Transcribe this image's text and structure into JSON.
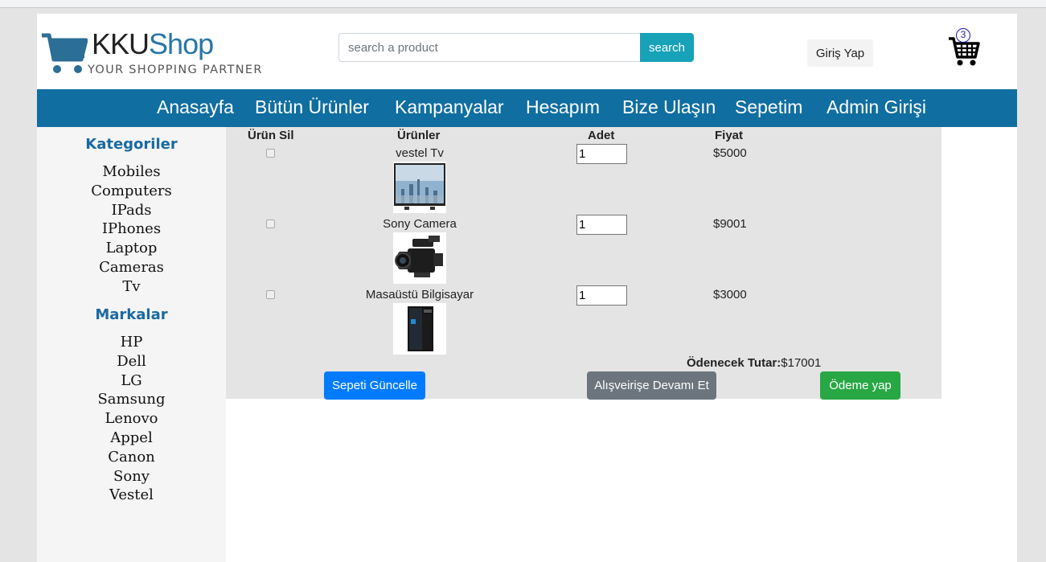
{
  "header": {
    "logo": {
      "brand_part1": "KKU",
      "brand_part2": "Shop",
      "tagline": "YOUR SHOPPING PARTNER"
    },
    "search": {
      "placeholder": "search a product",
      "value": "",
      "button_label": "search"
    },
    "login_label": "Giriş Yap",
    "cart_count": "3"
  },
  "nav": {
    "items": [
      "Anasayfa",
      "Bütün Ürünler",
      "Kampanyalar",
      "Hesapım",
      "Bize Ulaşın",
      "Sepetim",
      "Admin Girişi"
    ]
  },
  "sidebar": {
    "categories_title": "Kategoriler",
    "categories": [
      "Mobiles",
      "Computers",
      "IPads",
      "IPhones",
      "Laptop",
      "Cameras",
      "Tv"
    ],
    "brands_title": "Markalar",
    "brands": [
      "HP",
      "Dell",
      "LG",
      "Samsung",
      "Lenovo",
      "Appel",
      "Canon",
      "Sony",
      "Vestel"
    ]
  },
  "cart": {
    "columns": {
      "remove": "Ürün Sil",
      "products": "Ürünler",
      "quantity": "Adet",
      "price": "Fiyat"
    },
    "items": [
      {
        "name": "vestel Tv",
        "quantity": "1",
        "price": "$5000",
        "image_icon": "tv-image"
      },
      {
        "name": "Sony Camera",
        "quantity": "1",
        "price": "$9001",
        "image_icon": "camera-image"
      },
      {
        "name": "Masaüstü Bilgisayar",
        "quantity": "1",
        "price": "$3000",
        "image_icon": "desktop-pc-image"
      }
    ],
    "total_label": "Ödenecek Tutar:",
    "total_value": "$17001",
    "buttons": {
      "update": "Sepeti Güncelle",
      "continue": "Alışveirişe Devamı Et",
      "pay": "Ödeme yap"
    }
  },
  "colors": {
    "nav_bg": "#106ea1",
    "accent": "#1a6aa0",
    "search_btn": "#17a2b8",
    "update_btn": "#007bff",
    "continue_btn": "#6c757d",
    "pay_btn": "#28a745"
  }
}
